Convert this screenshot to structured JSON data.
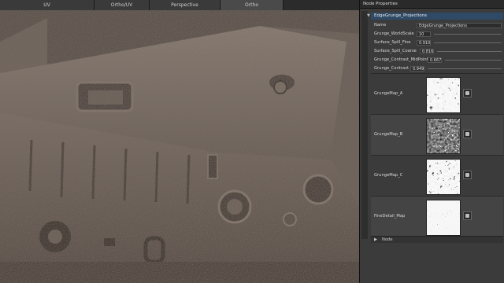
{
  "viewport": {
    "tabs": [
      {
        "label": "UV",
        "active": false
      },
      {
        "label": "Ortho/UV",
        "active": false
      },
      {
        "label": "Perspective",
        "active": false
      },
      {
        "label": "Ortho",
        "active": true
      }
    ]
  },
  "panel": {
    "title": "Node Properties",
    "section": "EdgeGrunge_Projections",
    "properties": [
      {
        "label": "Name",
        "value": "EdgeGrunge_Projections"
      },
      {
        "label": "Grunge_WorldScale",
        "value": "10"
      },
      {
        "label": "Surface_Spill_Fine",
        "value": "0.910"
      },
      {
        "label": "Surface_Spill_Coarse",
        "value": "0.816"
      },
      {
        "label": "Grunge_Contrast_MidPoint",
        "value": "0.667"
      },
      {
        "label": "Grunge_Contrast",
        "value": "0.949"
      }
    ],
    "maps": [
      {
        "label": "GrungeMap_A"
      },
      {
        "label": "GrungeMap_B"
      },
      {
        "label": "GrungeMap_C"
      },
      {
        "label": "FineDetail_Map"
      }
    ],
    "footer": "Node"
  },
  "colors": {
    "section_header": "#2f4a66",
    "panel_bg": "#3b3b3b",
    "surface_grunge": "#6b625b"
  }
}
